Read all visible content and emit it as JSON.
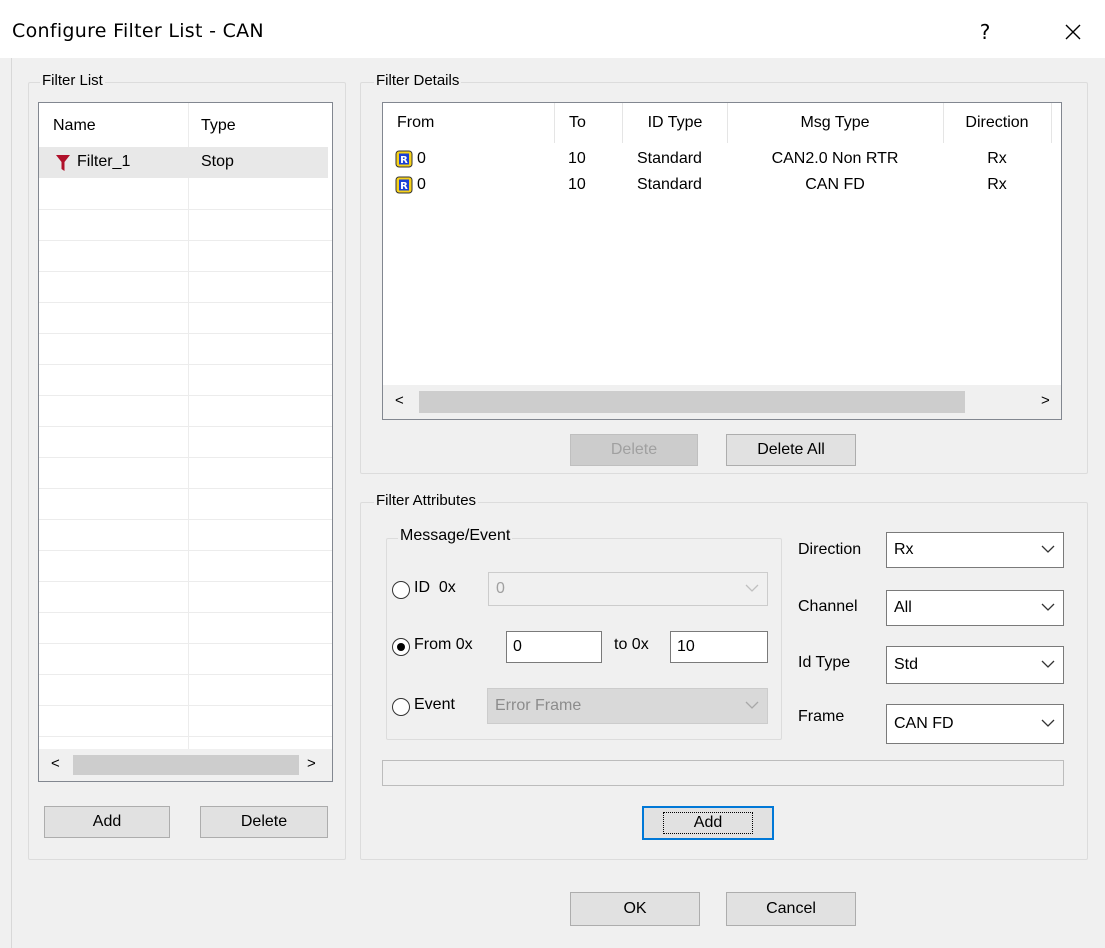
{
  "window": {
    "title": "Configure Filter List - CAN",
    "help_label": "?",
    "close_label": "✕"
  },
  "filter_list": {
    "group_label": "Filter List",
    "columns": [
      "Name",
      "Type"
    ],
    "rows": [
      {
        "name": "Filter_1",
        "type": "Stop"
      }
    ],
    "scroll_left": "<",
    "scroll_right": ">",
    "add_label": "Add",
    "delete_label": "Delete"
  },
  "filter_details": {
    "group_label": "Filter Details",
    "columns": [
      "From",
      "To",
      "ID Type",
      "Msg Type",
      "Direction"
    ],
    "rows": [
      {
        "from": "0",
        "to": "10",
        "id_type": "Standard",
        "msg_type": "CAN2.0 Non RTR",
        "direction": "Rx"
      },
      {
        "from": "0",
        "to": "10",
        "id_type": "Standard",
        "msg_type": "CAN FD",
        "direction": "Rx"
      }
    ],
    "delete_label": "Delete",
    "delete_all_label": "Delete All"
  },
  "filter_attributes": {
    "group_label": "Filter Attributes",
    "message_event_label": "Message/Event",
    "id_label": "ID  0x",
    "id_value": "0",
    "from_label": "From 0x",
    "from_value": "0",
    "to_label": "to 0x",
    "to_value": "10",
    "event_label": "Event",
    "event_value": "Error Frame",
    "selected_mode": "from",
    "direction_label": "Direction",
    "direction_value": "Rx",
    "channel_label": "Channel",
    "channel_value": "All",
    "id_type_label": "Id Type",
    "id_type_value": "Std",
    "frame_label": "Frame",
    "frame_value": "CAN FD",
    "add_label": "Add"
  },
  "footer": {
    "ok_label": "OK",
    "cancel_label": "Cancel"
  },
  "colors": {
    "filter_icon": "#b0102a",
    "r_icon_fill": "#f7d21a",
    "r_icon_letter": "#1a3fd6",
    "focus_border": "#0078d7"
  }
}
